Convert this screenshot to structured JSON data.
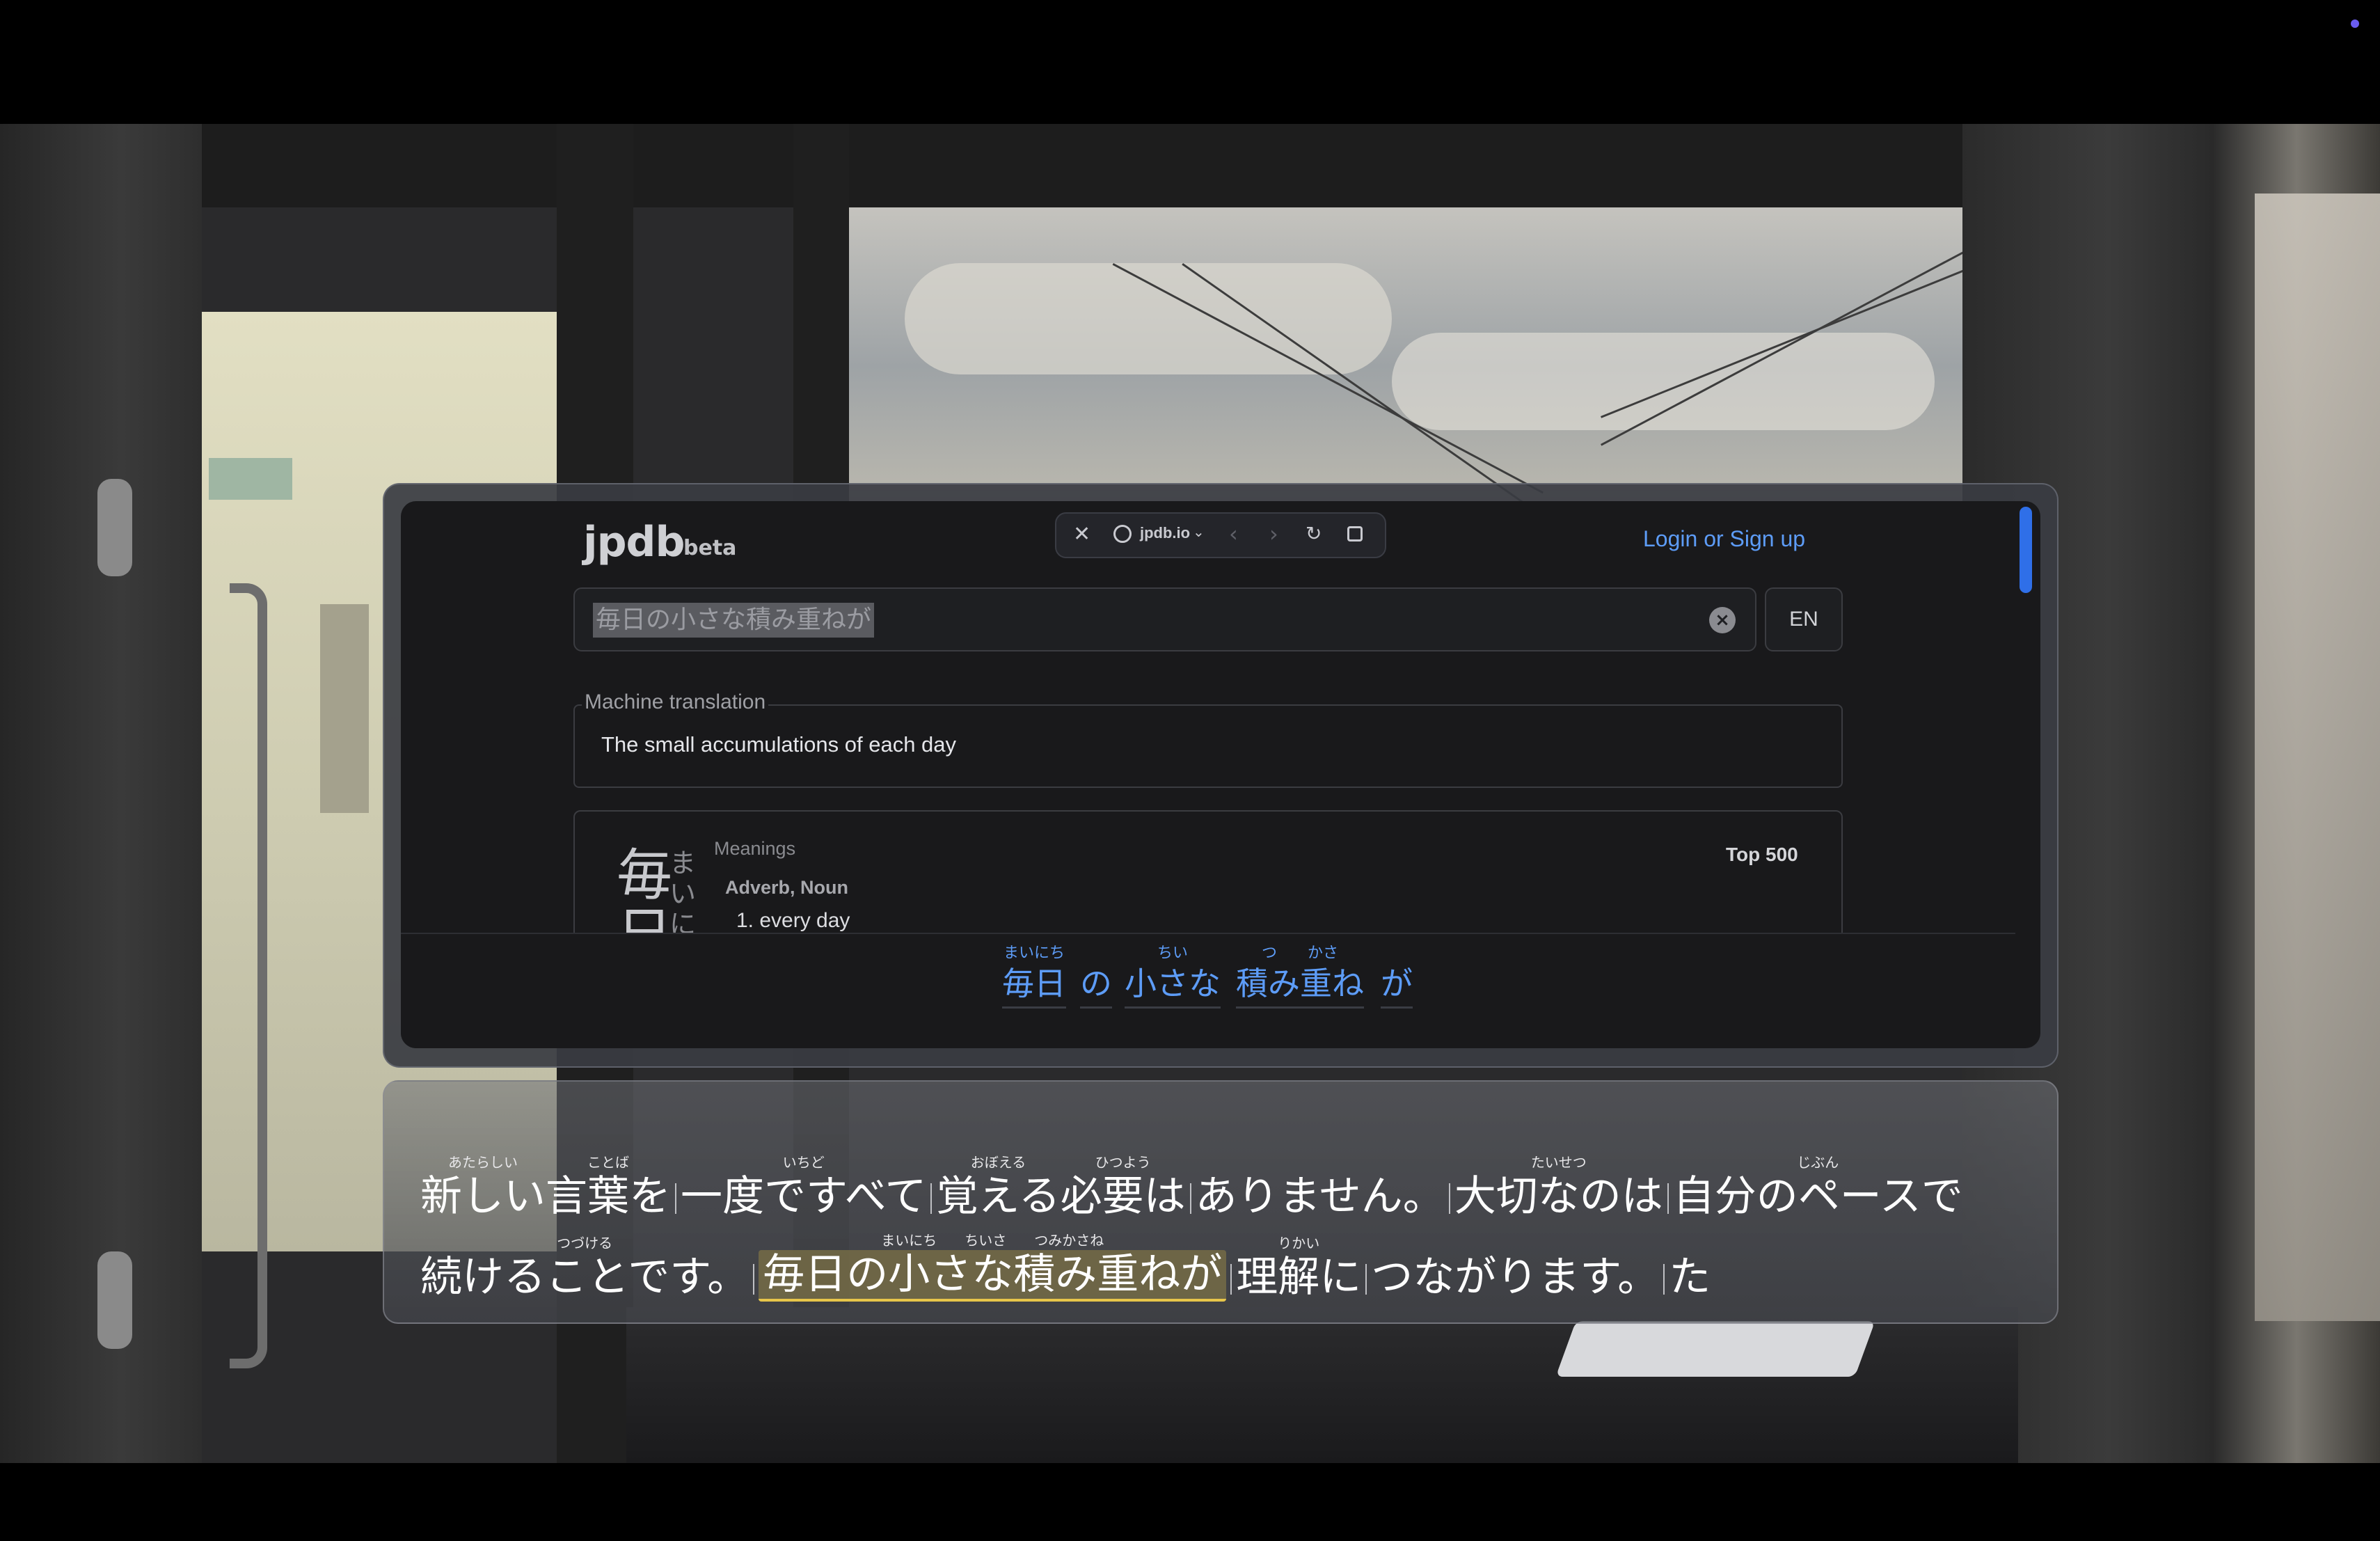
{
  "app": {
    "logo": "jpdb",
    "logo_badge": "beta",
    "login_label": "Login or Sign up"
  },
  "browser_bar": {
    "url": "jpdb.io",
    "icons": [
      "close-icon",
      "globe-icon",
      "chevron-down-icon",
      "back-icon",
      "forward-icon",
      "reload-icon",
      "open-external-icon"
    ]
  },
  "search": {
    "value": "毎日の小さな積み重ねが",
    "language_button": "EN"
  },
  "machine_translation": {
    "label": "Machine translation",
    "text": "The small accumulations of each day"
  },
  "entry": {
    "kanji": "毎日",
    "kana": "まいにち",
    "meanings_label": "Meanings",
    "part_of_speech": "Adverb, Noun",
    "definition": "1. every day",
    "frequency": "Top 500"
  },
  "sentence_tokens": [
    {
      "base": "毎日",
      "reading": "まいにち"
    },
    {
      "base": "の",
      "reading": ""
    },
    {
      "base": "小さな",
      "reading": "ちい"
    },
    {
      "base": "積み重ね",
      "reading": "つ　　かさ"
    },
    {
      "base": "が",
      "reading": ""
    }
  ],
  "subtitles": {
    "line1": [
      {
        "base": "新しい",
        "reading": "あたらしい"
      },
      {
        "base": "言葉を",
        "reading": "ことば"
      },
      {
        "sep": true
      },
      {
        "base": "一度ですべて",
        "reading": "いちど"
      },
      {
        "sep": true
      },
      {
        "base": "覚える",
        "reading": "おぼえる"
      },
      {
        "base": "必要は",
        "reading": "ひつよう"
      },
      {
        "sep": true
      },
      {
        "base": "ありません。",
        "reading": ""
      },
      {
        "sep": true
      },
      {
        "base": "大切なのは",
        "reading": "たいせつ"
      },
      {
        "sep": true
      },
      {
        "base": "自分のペースで",
        "reading": "じぶん"
      }
    ],
    "line2": [
      {
        "base": "続けることです。",
        "reading": "つづける"
      },
      {
        "sep": true
      },
      {
        "base": "毎日の小さな積み重ねが",
        "reading": "まいにち　　ちいさ　　つみかさね",
        "highlight": true
      },
      {
        "sep": true
      },
      {
        "base": "理解に",
        "reading": "りかい"
      },
      {
        "sep": true
      },
      {
        "base": "つながります。",
        "reading": ""
      },
      {
        "sep": true
      },
      {
        "base": "た",
        "reading": ""
      }
    ]
  },
  "colors": {
    "accent": "#5d9cf7",
    "highlight": "#e7c54a",
    "panel": "#19191b"
  }
}
